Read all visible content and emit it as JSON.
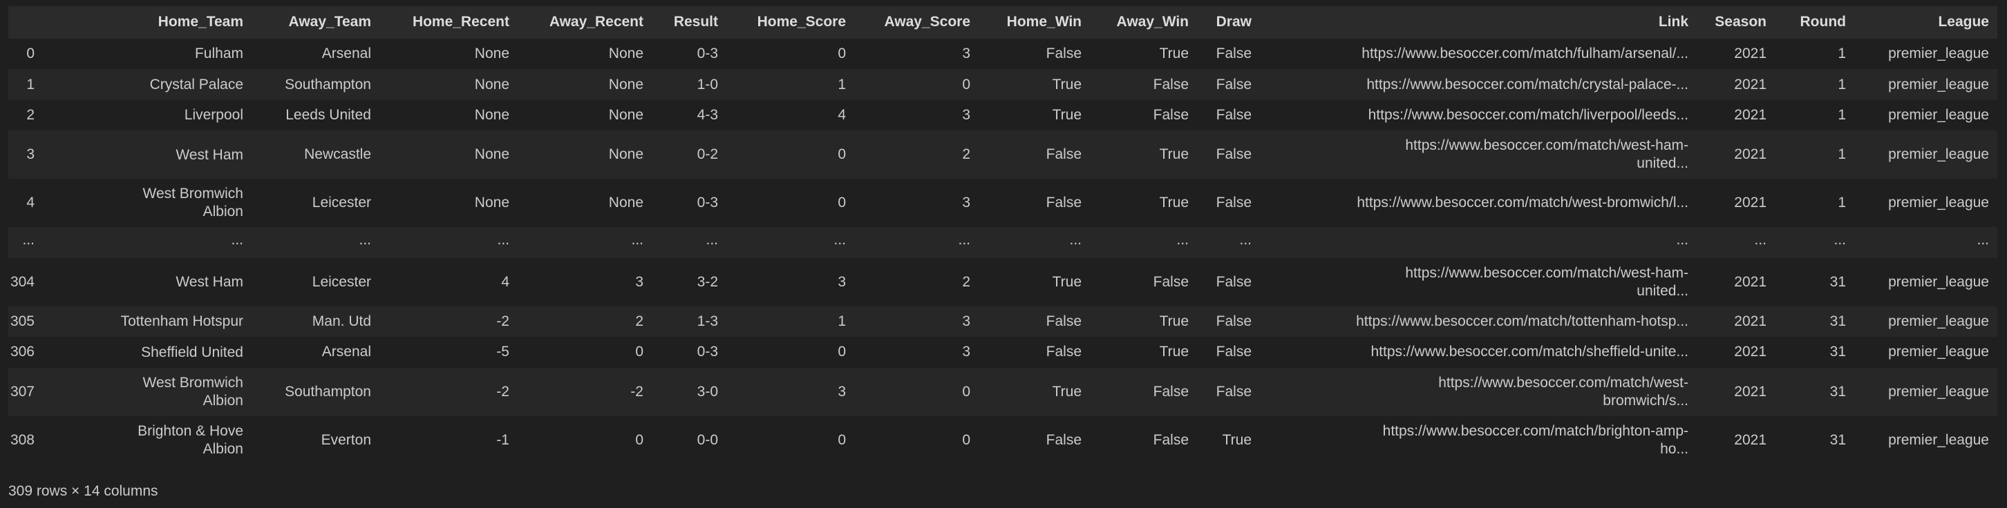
{
  "table": {
    "columns": [
      "",
      "Home_Team",
      "Away_Team",
      "Home_Recent",
      "Away_Recent",
      "Result",
      "Home_Score",
      "Away_Score",
      "Home_Win",
      "Away_Win",
      "Draw",
      "Link",
      "Season",
      "Round",
      "League"
    ],
    "rows": [
      [
        "0",
        "Fulham",
        "Arsenal",
        "None",
        "None",
        "0-3",
        "0",
        "3",
        "False",
        "True",
        "False",
        "https://www.besoccer.com/match/fulham/arsenal/...",
        "2021",
        "1",
        "premier_league"
      ],
      [
        "1",
        "Crystal Palace",
        "Southampton",
        "None",
        "None",
        "1-0",
        "1",
        "0",
        "True",
        "False",
        "False",
        "https://www.besoccer.com/match/crystal-palace-...",
        "2021",
        "1",
        "premier_league"
      ],
      [
        "2",
        "Liverpool",
        "Leeds United",
        "None",
        "None",
        "4-3",
        "4",
        "3",
        "True",
        "False",
        "False",
        "https://www.besoccer.com/match/liverpool/leeds...",
        "2021",
        "1",
        "premier_league"
      ],
      [
        "3",
        "West Ham",
        "Newcastle",
        "None",
        "None",
        "0-2",
        "0",
        "2",
        "False",
        "True",
        "False",
        "https://www.besoccer.com/match/west-ham-\nunited...",
        "2021",
        "1",
        "premier_league"
      ],
      [
        "4",
        "West Bromwich Albion",
        "Leicester",
        "None",
        "None",
        "0-3",
        "0",
        "3",
        "False",
        "True",
        "False",
        "https://www.besoccer.com/match/west-bromwich/l...",
        "2021",
        "1",
        "premier_league"
      ],
      [
        "...",
        "...",
        "...",
        "...",
        "...",
        "...",
        "...",
        "...",
        "...",
        "...",
        "...",
        "...",
        "...",
        "...",
        "..."
      ],
      [
        "304",
        "West Ham",
        "Leicester",
        "4",
        "3",
        "3-2",
        "3",
        "2",
        "True",
        "False",
        "False",
        "https://www.besoccer.com/match/west-ham-\nunited...",
        "2021",
        "31",
        "premier_league"
      ],
      [
        "305",
        "Tottenham Hotspur",
        "Man. Utd",
        "-2",
        "2",
        "1-3",
        "1",
        "3",
        "False",
        "True",
        "False",
        "https://www.besoccer.com/match/tottenham-hotsp...",
        "2021",
        "31",
        "premier_league"
      ],
      [
        "306",
        "Sheffield United",
        "Arsenal",
        "-5",
        "0",
        "0-3",
        "0",
        "3",
        "False",
        "True",
        "False",
        "https://www.besoccer.com/match/sheffield-unite...",
        "2021",
        "31",
        "premier_league"
      ],
      [
        "307",
        "West Bromwich Albion",
        "Southampton",
        "-2",
        "-2",
        "3-0",
        "3",
        "0",
        "True",
        "False",
        "False",
        "https://www.besoccer.com/match/west-\nbromwich/s...",
        "2021",
        "31",
        "premier_league"
      ],
      [
        "308",
        "Brighton & Hove Albion",
        "Everton",
        "-1",
        "0",
        "0-0",
        "0",
        "0",
        "False",
        "False",
        "True",
        "https://www.besoccer.com/match/brighton-amp-\nho...",
        "2021",
        "31",
        "premier_league"
      ]
    ]
  },
  "footer": {
    "shape": "309 rows × 14 columns"
  },
  "colors": {
    "background": "#1f1f1f",
    "header": "#2b2b2b",
    "row_alt": "#272727",
    "text": "#cccccc"
  }
}
